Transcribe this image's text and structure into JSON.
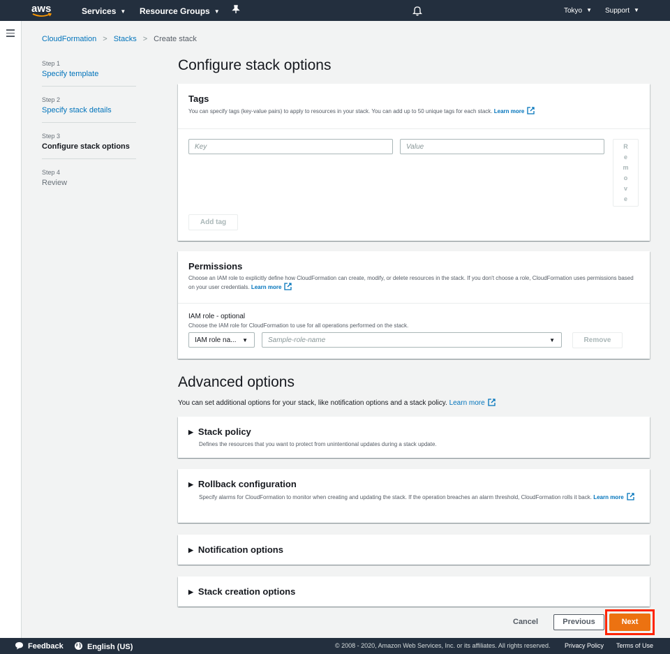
{
  "topnav": {
    "logo_text": "aws",
    "services": "Services",
    "resource_groups": "Resource Groups",
    "region": "Tokyo",
    "support": "Support"
  },
  "breadcrumb": [
    "CloudFormation",
    "Stacks",
    "Create stack"
  ],
  "steps": [
    {
      "num": "Step 1",
      "label": "Specify template"
    },
    {
      "num": "Step 2",
      "label": "Specify stack details"
    },
    {
      "num": "Step 3",
      "label": "Configure stack options"
    },
    {
      "num": "Step 4",
      "label": "Review"
    }
  ],
  "page_title": "Configure stack options",
  "tags": {
    "title": "Tags",
    "desc": "You can specify tags (key-value pairs) to apply to resources in your stack. You can add up to 50 unique tags for each stack.",
    "learn_more": "Learn more",
    "key_placeholder": "Key",
    "value_placeholder": "Value",
    "remove_letters": [
      "R",
      "e",
      "m",
      "o",
      "v",
      "e"
    ],
    "add_tag": "Add tag"
  },
  "permissions": {
    "title": "Permissions",
    "desc": "Choose an IAM role to explicitly define how CloudFormation can create, modify, or delete resources in the stack. If you don't choose a role, CloudFormation uses permissions based on your user credentials.",
    "learn_more": "Learn more",
    "iam_label": "IAM role - optional",
    "iam_desc": "Choose the IAM role for CloudFormation to use for all operations performed on the stack.",
    "iam_type": "IAM role na...",
    "role_placeholder": "Sample-role-name",
    "remove": "Remove"
  },
  "advanced": {
    "title": "Advanced options",
    "desc": "You can set additional options for your stack, like notification options and a stack policy.",
    "learn_more": "Learn more",
    "stack_policy": {
      "title": "Stack policy",
      "desc": "Defines the resources that you want to protect from unintentional updates during a stack update."
    },
    "rollback": {
      "title": "Rollback configuration",
      "desc": "Specify alarms for CloudFormation to monitor when creating and updating the stack. If the operation breaches an alarm threshold, CloudFormation rolls it back.",
      "learn_more": "Learn more"
    },
    "notification": {
      "title": "Notification options"
    },
    "creation": {
      "title": "Stack creation options"
    }
  },
  "actions": {
    "cancel": "Cancel",
    "previous": "Previous",
    "next": "Next"
  },
  "footer": {
    "feedback": "Feedback",
    "language": "English (US)",
    "copyright": "© 2008 - 2020, Amazon Web Services, Inc. or its affiliates. All rights reserved.",
    "privacy": "Privacy Policy",
    "terms": "Terms of Use"
  }
}
